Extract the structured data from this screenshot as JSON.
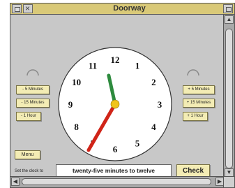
{
  "window": {
    "title": "Doorway"
  },
  "left_buttons": [
    {
      "label": "- 5 Minutes"
    },
    {
      "label": "- 15 Minutes"
    },
    {
      "label": "- 1 Hour"
    }
  ],
  "right_buttons": [
    {
      "label": "+ 5 Minutes"
    },
    {
      "label": "+ 15 Minutes"
    },
    {
      "label": "+ 1 Hour"
    }
  ],
  "clock": {
    "numerals": [
      "12",
      "1",
      "2",
      "3",
      "4",
      "5",
      "6",
      "7",
      "8",
      "9",
      "10",
      "11"
    ],
    "hour_hand_color": "#2e8b3e",
    "minute_hand_color": "#d02418",
    "center_color": "#f0c419",
    "time_hours": 11,
    "time_minutes": 35
  },
  "footer": {
    "menu_label": "Menu",
    "set_label": "Set the clock to",
    "answer_text": "twenty-five minutes to twelve",
    "check_label": "Check"
  }
}
